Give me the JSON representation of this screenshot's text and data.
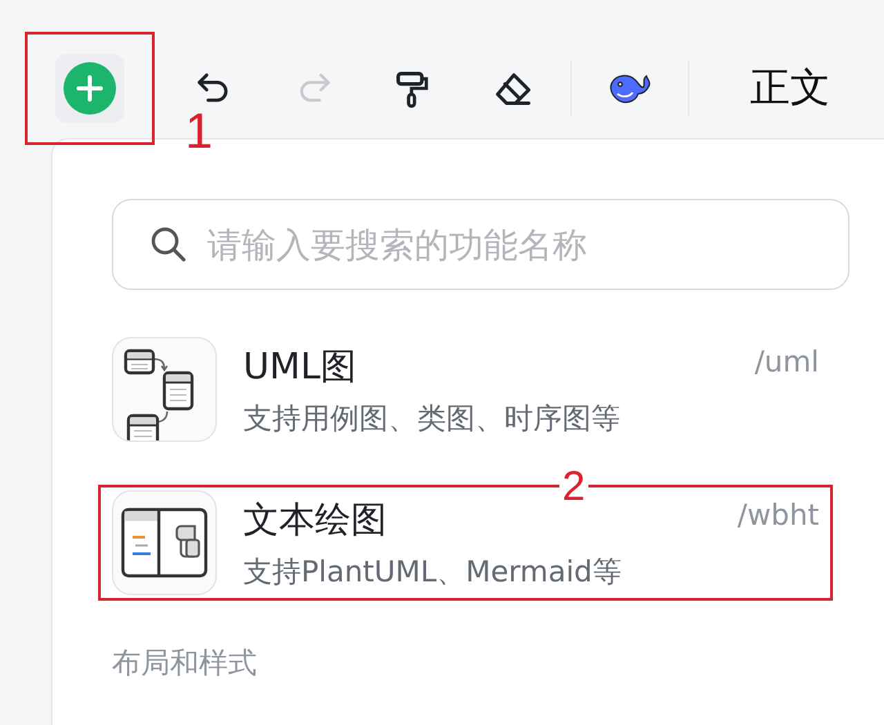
{
  "toolbar": {
    "tools": [
      {
        "kind": "insert",
        "disabled": false,
        "callout": "1"
      },
      {
        "kind": "undo",
        "disabled": false
      },
      {
        "kind": "redo",
        "disabled": true
      },
      {
        "kind": "painter",
        "disabled": false
      },
      {
        "kind": "eraser",
        "disabled": false
      },
      {
        "kind": "divider"
      },
      {
        "kind": "whale",
        "disabled": false
      },
      {
        "kind": "divider"
      }
    ],
    "style_label": "正文"
  },
  "panel": {
    "search": {
      "placeholder": "请输入要搜索的功能名称"
    },
    "items": [
      {
        "kind": "uml",
        "title": "UML图",
        "description": "支持用例图、类图、时序图等",
        "command": "/uml"
      },
      {
        "kind": "text-diagram",
        "title": "文本绘图",
        "description": "支持PlantUML、Mermaid等",
        "command": "/wbht",
        "callout": "2"
      }
    ],
    "section_title": "布局和样式"
  }
}
